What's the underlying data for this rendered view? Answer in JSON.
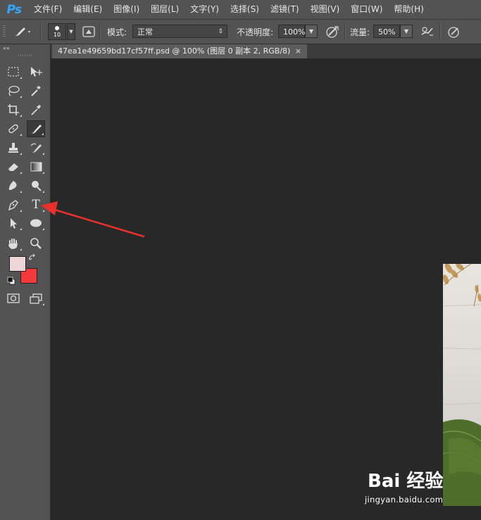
{
  "app": {
    "logo": "Ps"
  },
  "menu": [
    "文件(F)",
    "编辑(E)",
    "图像(I)",
    "图层(L)",
    "文字(Y)",
    "选择(S)",
    "滤镜(T)",
    "视图(V)",
    "窗口(W)",
    "帮助(H)"
  ],
  "options": {
    "brush_size": "10",
    "mode_label": "模式:",
    "mode_value": "正常",
    "opacity_label": "不透明度:",
    "opacity_value": "100%",
    "flow_label": "流量:",
    "flow_value": "50%"
  },
  "document_tab": {
    "title": "47ea1e49659bd17cf57ff.psd @ 100% (图层 0 副本 2, RGB/8)",
    "close": "×"
  },
  "toolbar": {
    "collapse": "««",
    "type_tool_glyph": "T"
  },
  "colors": {
    "foreground": "#eed6d6",
    "background": "#f23a3c",
    "annotation_arrow": "#e8312c",
    "ps_blue": "#31a8ff"
  },
  "icons": [
    "brush-icon",
    "brush-preset-icon",
    "mode-dropdown-icon",
    "airbrush-icon",
    "pressure-opacity-icon",
    "pressure-size-icon",
    "rect-marquee-icon",
    "move-icon",
    "lasso-icon",
    "magic-wand-icon",
    "crop-icon",
    "eyedropper-icon",
    "healing-brush-icon",
    "brush-tool-icon",
    "clone-stamp-icon",
    "history-brush-icon",
    "eraser-icon",
    "gradient-icon",
    "blur-icon",
    "dodge-icon",
    "pen-icon",
    "type-icon",
    "path-select-icon",
    "ellipse-icon",
    "hand-icon",
    "zoom-icon",
    "swap-colors-icon",
    "default-colors-icon",
    "quick-mask-icon",
    "screen-mode-icon"
  ],
  "watermark": {
    "logo": "Bai 经验",
    "site": "jingyan.baidu.com"
  }
}
